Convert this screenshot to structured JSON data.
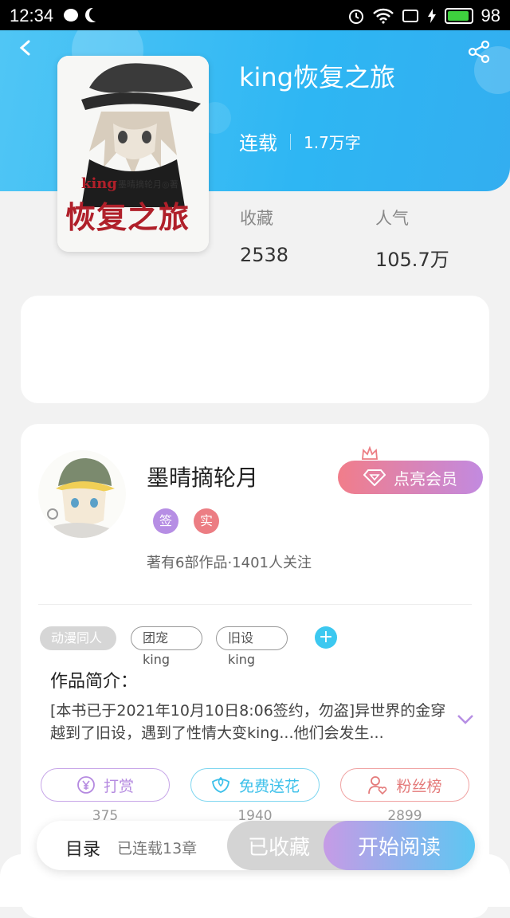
{
  "status_bar": {
    "time": "12:34",
    "battery": "98"
  },
  "book": {
    "title": "king恢复之旅",
    "status": "连载",
    "word_count": "1.7万字",
    "cover_text": {
      "main": "恢复之旅",
      "latin": "king",
      "author": "墨晴摘轮月◎著"
    },
    "stats": [
      {
        "label": "收藏",
        "value": "2538"
      },
      {
        "label": "人气",
        "value": "105.7万"
      }
    ]
  },
  "author": {
    "name": "墨晴摘轮月",
    "badges": [
      "签",
      "实"
    ],
    "meta": "著有6部作品·1401人关注",
    "vip_button": "点亮会员"
  },
  "tags": [
    "动漫同人",
    "团宠king",
    "旧设king"
  ],
  "intro": {
    "title": "作品简介：",
    "text": "[本书已于2021年10月10日8:06签约，勿盗]异世界的金穿越到了旧设，遇到了性情大变king...他们会发生..."
  },
  "actions": [
    {
      "label": "打赏",
      "count": "375"
    },
    {
      "label": "免费送花",
      "count": "1940"
    },
    {
      "label": "粉丝榜",
      "count": "2899"
    }
  ],
  "bottom": {
    "toc_label": "目录",
    "toc_count": "已连载13章",
    "fav_label": "已收藏",
    "read_label": "开始阅读"
  },
  "colors": {
    "header": "#2eb6f3",
    "accent_purple": "#b58ae0",
    "accent_blue": "#3cc8f0",
    "accent_red": "#e47a7a"
  }
}
